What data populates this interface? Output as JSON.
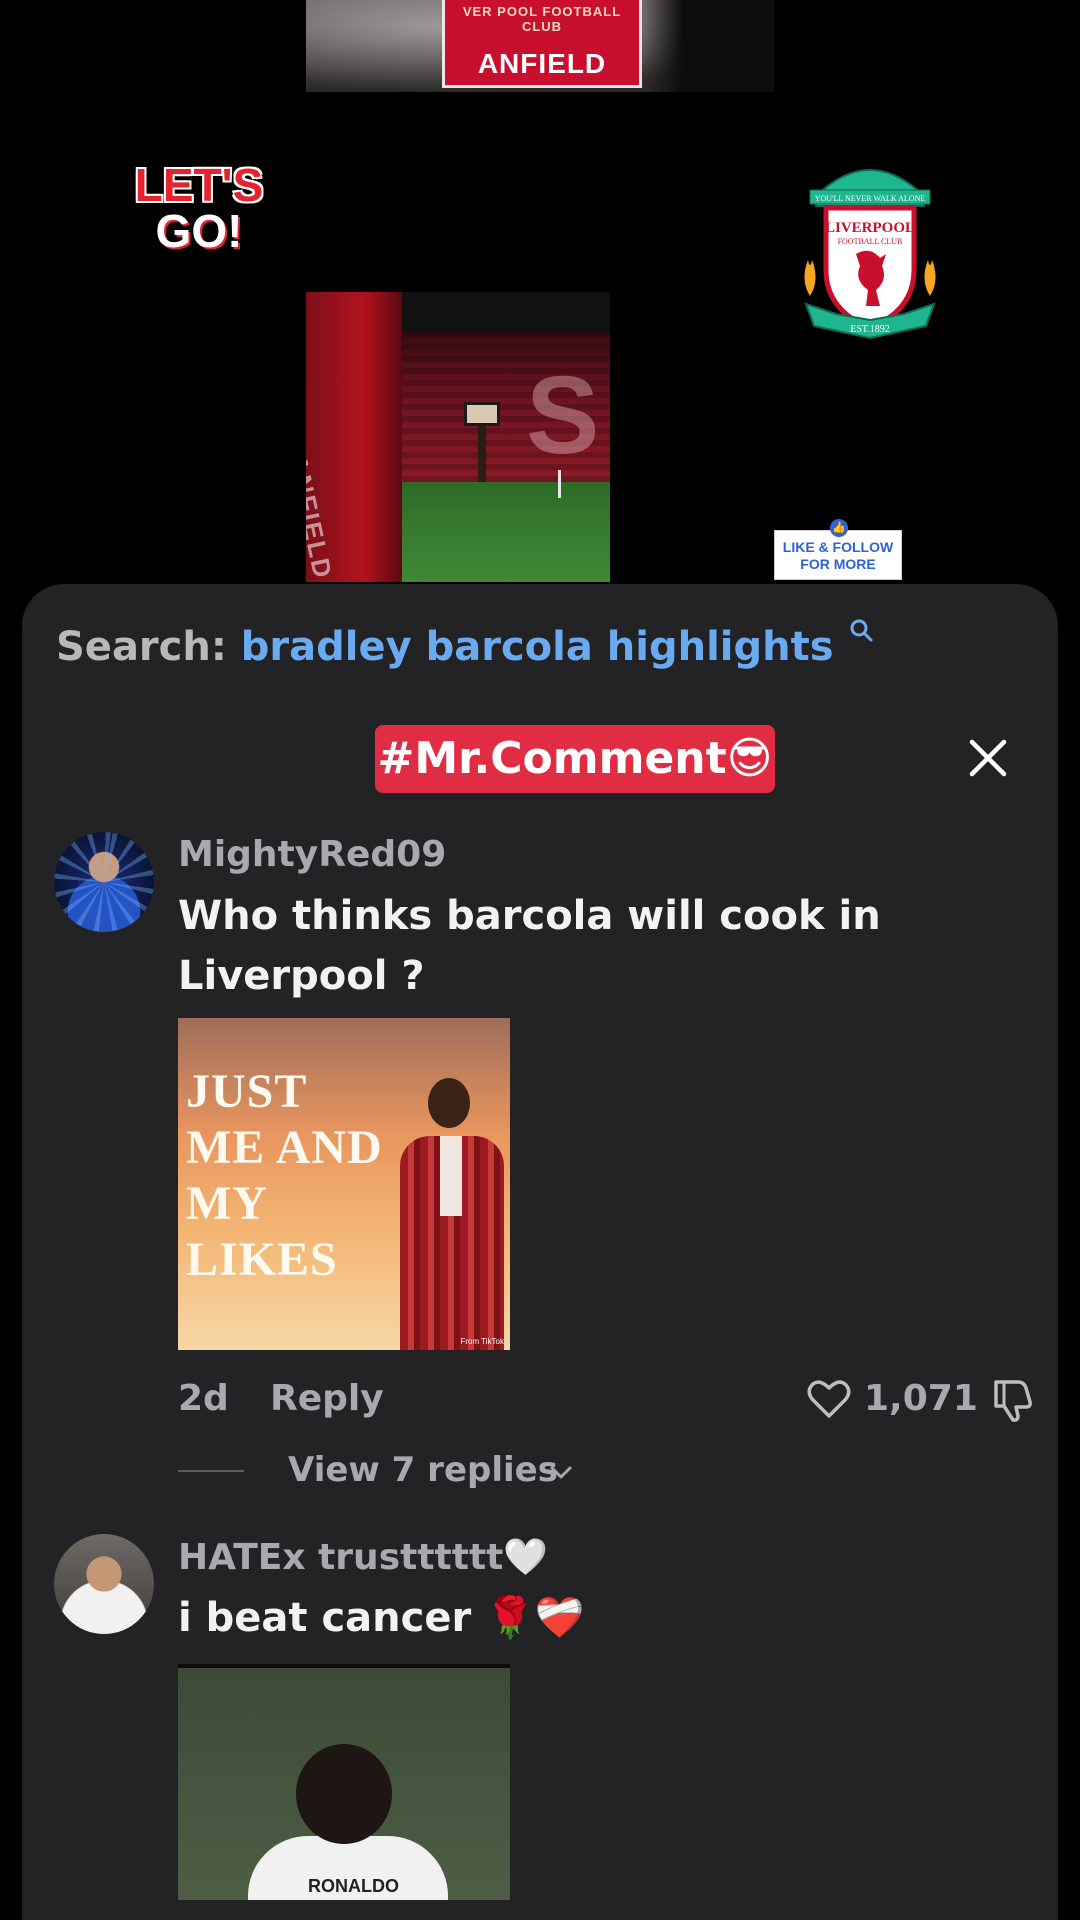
{
  "video": {
    "anfield_sign_arc": "VER POOL FOOTBALL CLUB",
    "anfield_sign_word": "ANFIELD",
    "lets_go_line1": "LET'S",
    "lets_go_line2": "GO!",
    "like_follow_line1": "LIKE & FOLLOW",
    "like_follow_line2": "FOR MORE",
    "wall_text": "ANFIELD",
    "crest_motto": "YOU'LL NEVER WALK ALONE",
    "crest_name": "LIVERPOOL",
    "crest_sub": "FOOTBALL CLUB",
    "crest_est": "EST.1892"
  },
  "sheet": {
    "search_label": "Search:",
    "search_query": "bradley barcola highlights",
    "hashtag": "#Mr.Comment😎",
    "close_icon": "close-icon"
  },
  "comments": [
    {
      "username": "MightyRed09",
      "text": "Who thinks barcola will cook in Liverpool ?",
      "media_text": "JUST ME AND MY LIKES",
      "media_watermark": "From TikTok",
      "time": "2d",
      "reply_label": "Reply",
      "like_count": "1,071",
      "view_replies": "View 7 replies"
    },
    {
      "username": "HATEx trustttttt🤍",
      "text": "i beat cancer 🌹❤️‍🩹",
      "media_text": "RONALDO"
    }
  ],
  "colors": {
    "sheet_bg": "#232325",
    "accent_red": "#e12d44",
    "query_blue": "#6aaaf0",
    "muted_text": "#a9a9ad"
  }
}
